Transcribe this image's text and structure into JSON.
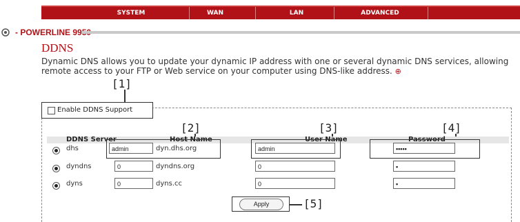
{
  "nav": {
    "tabs": [
      "SYSTEM",
      "WAN",
      "LAN",
      "ADVANCED"
    ]
  },
  "brand": {
    "name": "POWERLINE 9950"
  },
  "page": {
    "title": "DDNS",
    "description": "Dynamic DNS allows you to update your dynamic IP address with one or several dynamic DNS services, allowing remote access to your FTP or Web service on your computer using DNS-like address.",
    "help_glyph": "⊕"
  },
  "enable": {
    "label": "Enable DDNS Support",
    "checked": false
  },
  "table": {
    "headers": {
      "server": "DDNS Server",
      "host": "Host Name",
      "user": "User Name",
      "password": "Password"
    },
    "rows": [
      {
        "server": "dhs",
        "selected": true,
        "host_value": "admin",
        "host_suffix": "dyn.dhs.org",
        "user_value": "admin",
        "password_value": "•••••"
      },
      {
        "server": "dyndns",
        "selected": true,
        "host_value": "0",
        "host_suffix": "dyndns.org",
        "user_value": "0",
        "password_value": "•"
      },
      {
        "server": "dyns",
        "selected": true,
        "host_value": "0",
        "host_suffix": "dyns.cc",
        "user_value": "0",
        "password_value": "•"
      }
    ]
  },
  "apply": {
    "label": "Apply"
  },
  "callouts": [
    "[1]",
    "[2]",
    "[3]",
    "[4]",
    "[5]"
  ]
}
